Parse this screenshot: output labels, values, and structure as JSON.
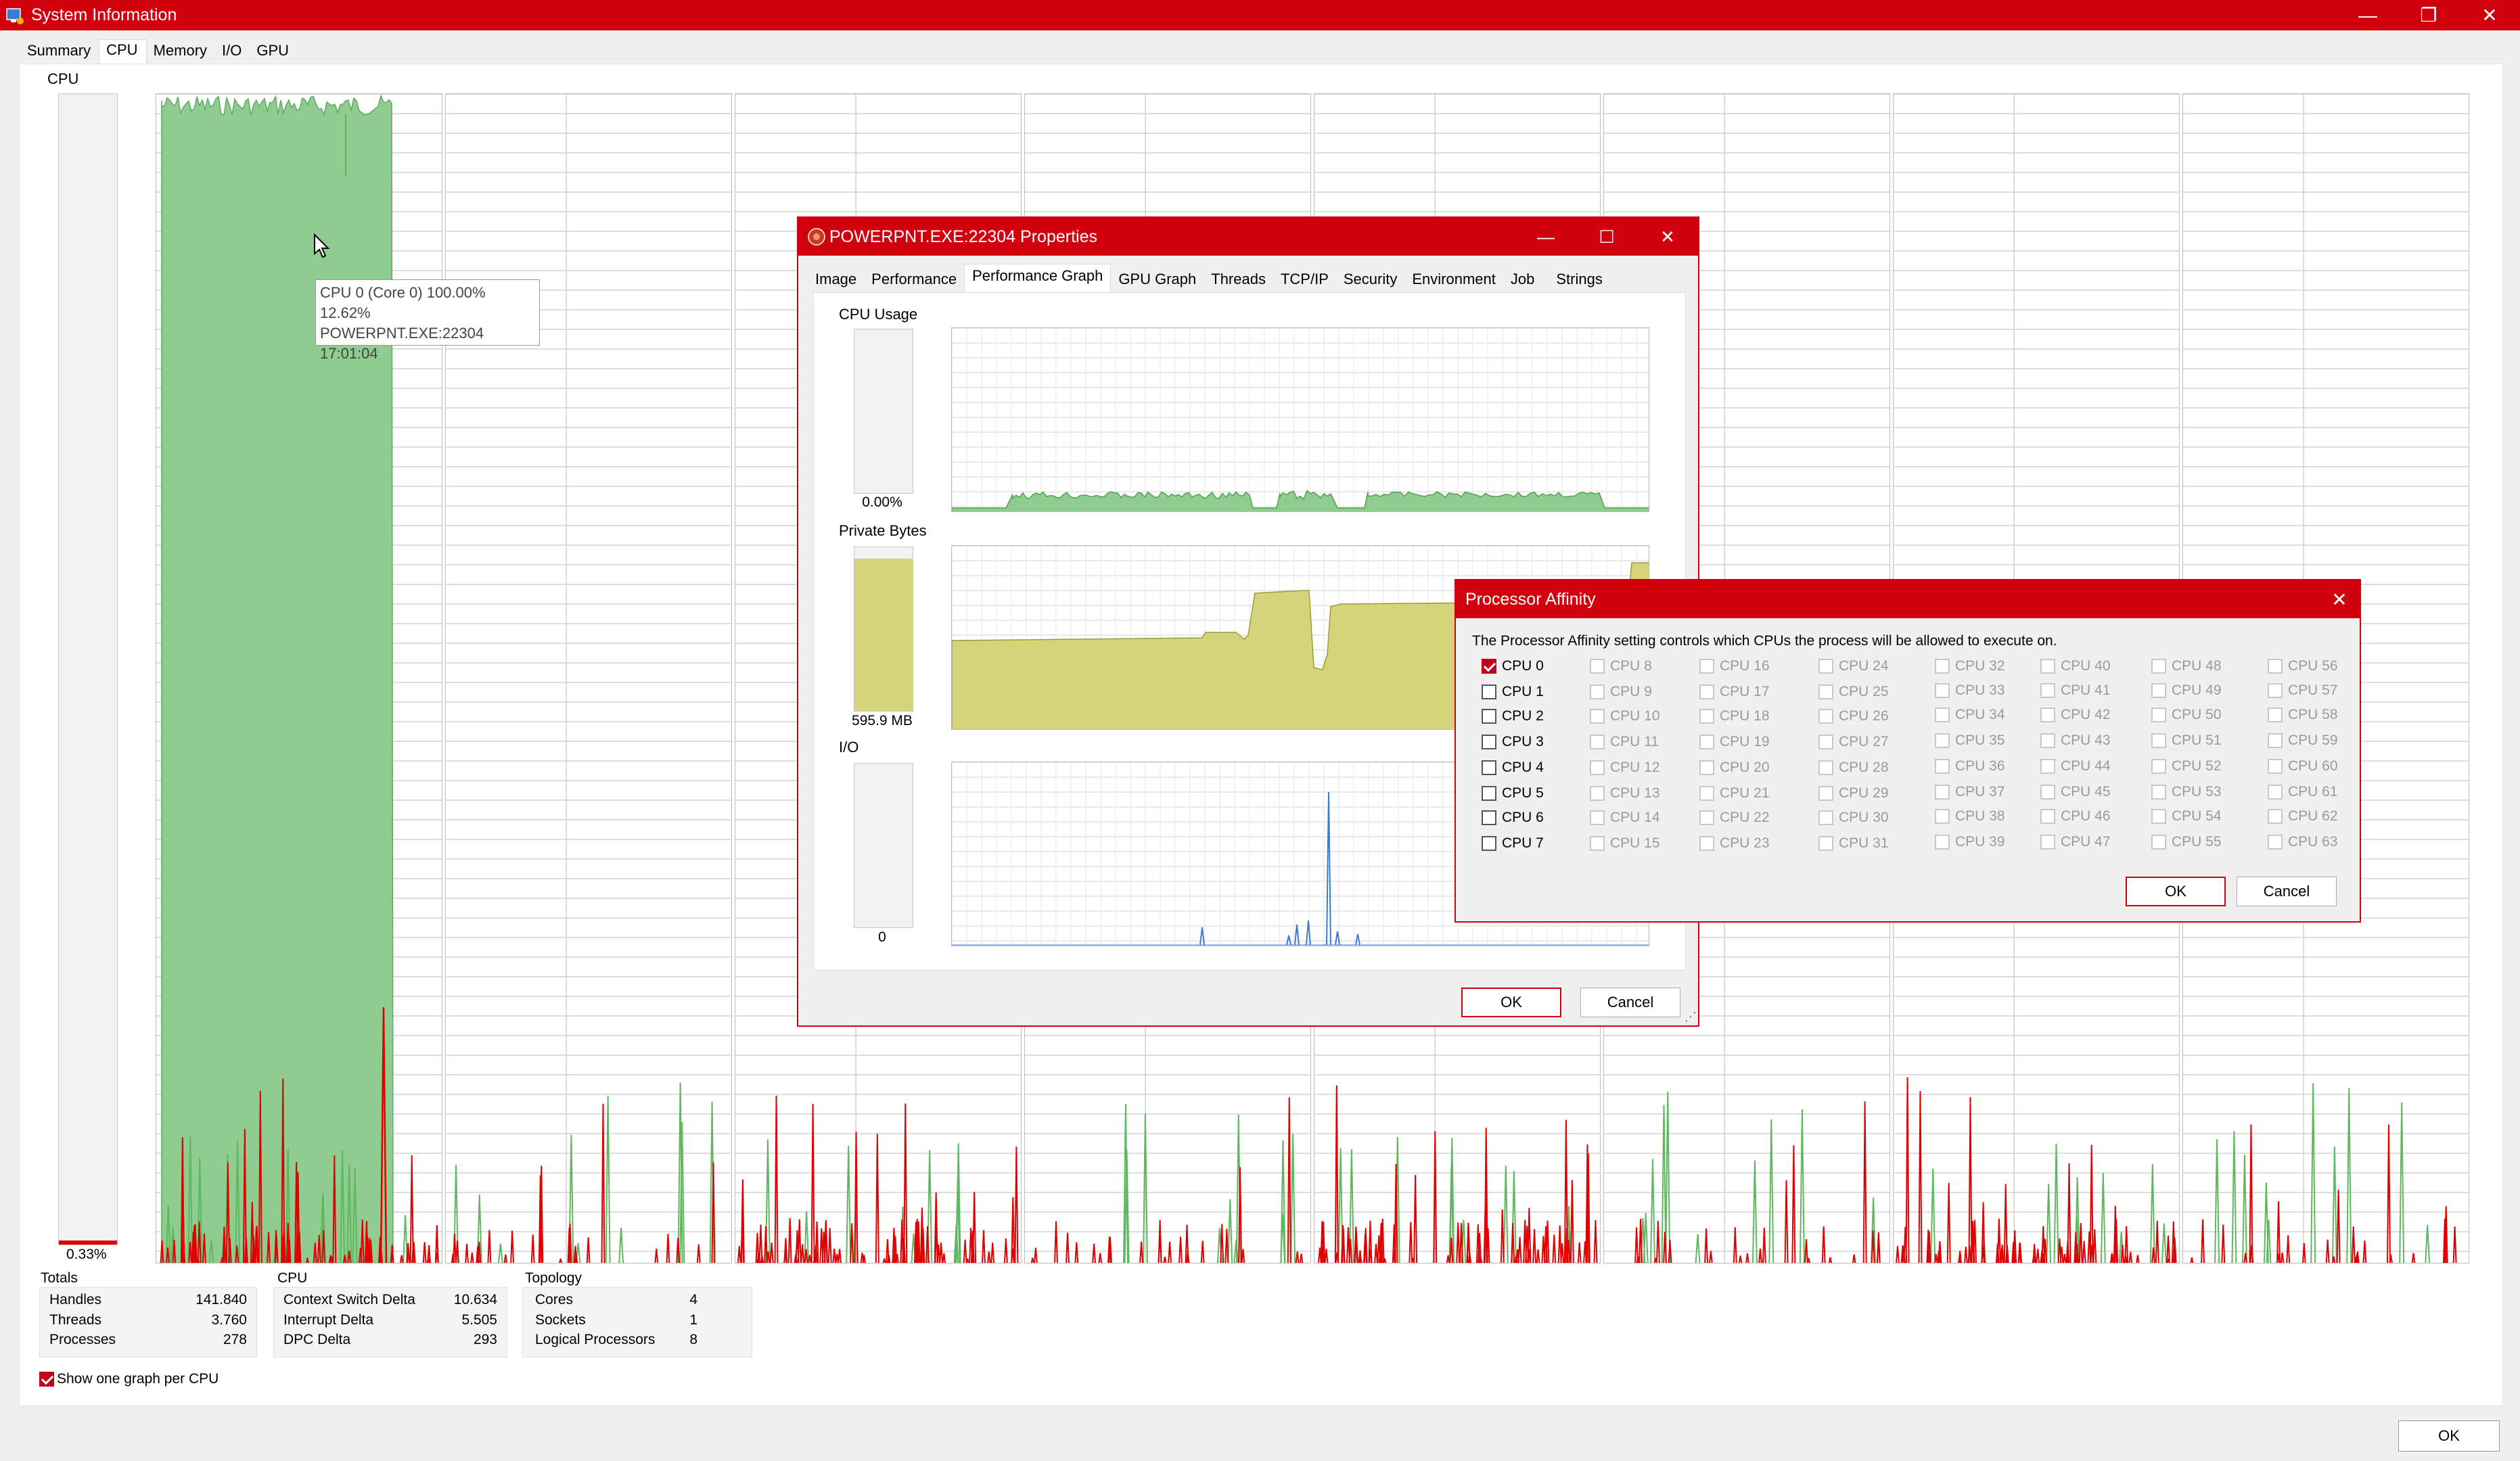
{
  "main_window": {
    "title": "System Information",
    "controls": {
      "minimize": "—",
      "restore": "❐",
      "close": "✕"
    },
    "tabs": [
      {
        "label": "Summary",
        "active": false
      },
      {
        "label": "CPU",
        "active": true
      },
      {
        "label": "Memory",
        "active": false
      },
      {
        "label": "I/O",
        "active": false
      },
      {
        "label": "GPU",
        "active": false
      }
    ],
    "cpu_label": "CPU",
    "cpu_percent": "0.33%",
    "cpu_fraction": 0.0033,
    "tooltip": {
      "line1": "CPU 0 (Core 0) 100.00%",
      "line2": "12.62% POWERPNT.EXE:22304",
      "line3": "17:01:04"
    },
    "totals": {
      "label": "Totals",
      "rows": [
        {
          "k": "Handles",
          "v": "141.840"
        },
        {
          "k": "Threads",
          "v": "3.760"
        },
        {
          "k": "Processes",
          "v": "278"
        }
      ]
    },
    "cpu_panel": {
      "label": "CPU",
      "rows": [
        {
          "k": "Context Switch Delta",
          "v": "10.634"
        },
        {
          "k": "Interrupt Delta",
          "v": "5.505"
        },
        {
          "k": "DPC Delta",
          "v": "293"
        }
      ]
    },
    "topology": {
      "label": "Topology",
      "rows": [
        {
          "k": "Cores",
          "v": "4"
        },
        {
          "k": "Sockets",
          "v": "1"
        },
        {
          "k": "Logical Processors",
          "v": "8"
        }
      ]
    },
    "show_one_graph_label": "Show one graph per CPU",
    "show_one_graph_checked": true,
    "ok_label": "OK",
    "colors": {
      "title_bar": "#d2000f",
      "graph_green": "#8fcc8f",
      "graph_red": "#e00000"
    }
  },
  "properties_dialog": {
    "title": "POWERPNT.EXE:22304 Properties",
    "tabs": [
      {
        "label": "Image",
        "active": false
      },
      {
        "label": "Performance",
        "active": false
      },
      {
        "label": "Performance Graph",
        "active": true
      },
      {
        "label": "GPU Graph",
        "active": false
      },
      {
        "label": "Threads",
        "active": false
      },
      {
        "label": "TCP/IP",
        "active": false
      },
      {
        "label": "Security",
        "active": false
      },
      {
        "label": "Environment",
        "active": false
      },
      {
        "label": "Job",
        "active": false
      },
      {
        "label": "Strings",
        "active": false
      }
    ],
    "cpu_usage": {
      "label": "CPU Usage",
      "value": "0.00%",
      "fraction": 0.0
    },
    "private_bytes": {
      "label": "Private Bytes",
      "value": "595.9 MB",
      "fraction": 0.93
    },
    "io": {
      "label": "I/O",
      "value": "0",
      "fraction": 0.0
    },
    "ok_label": "OK",
    "cancel_label": "Cancel",
    "colors": {
      "cpu_fill": "#8fcc8f",
      "bytes_fill": "#d4d47a",
      "io_line": "#3a7bd5"
    }
  },
  "affinity_dialog": {
    "title": "Processor Affinity",
    "description": "The Processor Affinity setting controls which CPUs the process will be allowed to execute on.",
    "cpus": [
      "CPU 0",
      "CPU 1",
      "CPU 2",
      "CPU 3",
      "CPU 4",
      "CPU 5",
      "CPU 6",
      "CPU 7",
      "CPU 8",
      "CPU 9",
      "CPU 10",
      "CPU 11",
      "CPU 12",
      "CPU 13",
      "CPU 14",
      "CPU 15",
      "CPU 16",
      "CPU 17",
      "CPU 18",
      "CPU 19",
      "CPU 20",
      "CPU 21",
      "CPU 22",
      "CPU 23",
      "CPU 24",
      "CPU 25",
      "CPU 26",
      "CPU 27",
      "CPU 28",
      "CPU 29",
      "CPU 30",
      "CPU 31",
      "CPU 32",
      "CPU 33",
      "CPU 34",
      "CPU 35",
      "CPU 36",
      "CPU 37",
      "CPU 38",
      "CPU 39",
      "CPU 40",
      "CPU 41",
      "CPU 42",
      "CPU 43",
      "CPU 44",
      "CPU 45",
      "CPU 46",
      "CPU 47",
      "CPU 48",
      "CPU 49",
      "CPU 50",
      "CPU 51",
      "CPU 52",
      "CPU 53",
      "CPU 54",
      "CPU 55",
      "CPU 56",
      "CPU 57",
      "CPU 58",
      "CPU 59",
      "CPU 60",
      "CPU 61",
      "CPU 62",
      "CPU 63"
    ],
    "checked": [
      "CPU 0"
    ],
    "enabled_count": 8,
    "ok_label": "OK",
    "cancel_label": "Cancel"
  }
}
